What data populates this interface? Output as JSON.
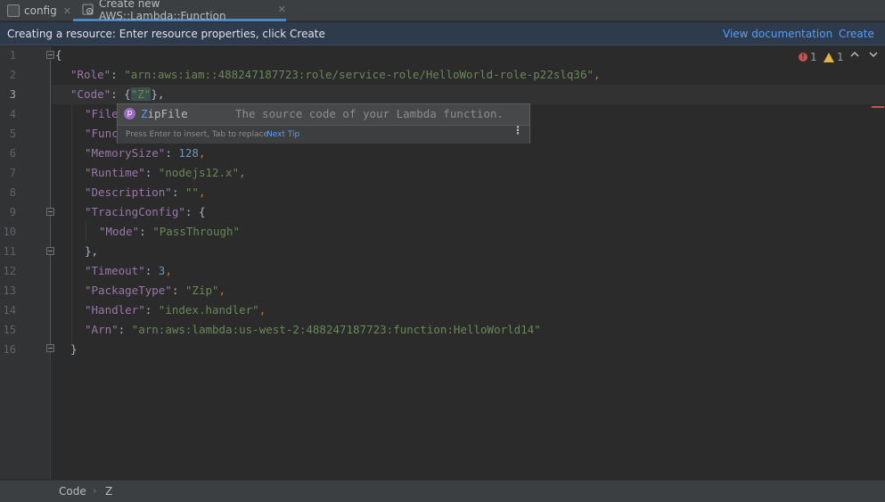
{
  "tabs": [
    {
      "label": "config",
      "close": "✕"
    },
    {
      "label": "Create new AWS::Lambda::Function",
      "close": "✕"
    }
  ],
  "banner": {
    "message": "Creating a resource: Enter resource properties, click Create",
    "doc_link": "View documentation",
    "create_link": "Create"
  },
  "inspections": {
    "errors": "1",
    "warnings": "1"
  },
  "gutter": {
    "line_numbers": [
      "1",
      "2",
      "3",
      "4",
      "5",
      "6",
      "7",
      "8",
      "9",
      "10",
      "11",
      "12",
      "13",
      "14",
      "15",
      "16"
    ],
    "current_line": "3"
  },
  "code": {
    "l1": "{",
    "l2_key": "\"Role\"",
    "l2_val": "\"arn:aws:iam::488247187723:role/service-role/HelloWorld-role-p22slq36\"",
    "l3_key": "\"Code\"",
    "l3_open": "{",
    "l3_val": "\"Z\"",
    "l3_close": "},",
    "l4_key": "\"File",
    "l5_key": "\"Func",
    "l6_key": "\"MemorySize\"",
    "l6_val": "128",
    "l7_key": "\"Runtime\"",
    "l7_val": "\"nodejs12.x\"",
    "l8_key": "\"Description\"",
    "l8_val": "\"\"",
    "l9_key": "\"TracingConfig\"",
    "l9_val": "{",
    "l10_key": "\"Mode\"",
    "l10_val": "\"PassThrough\"",
    "l11": "},",
    "l12_key": "\"Timeout\"",
    "l12_val": "3",
    "l13_key": "\"PackageType\"",
    "l13_val": "\"Zip\"",
    "l14_key": "\"Handler\"",
    "l14_val": "\"index.handler\"",
    "l15_key": "\"Arn\"",
    "l15_val": "\"arn:aws:lambda:us-west-2:488247187723:function:HelloWorld14\"",
    "l16": "}"
  },
  "completion": {
    "icon_letter": "p",
    "match": "Z",
    "rest": "ipFile",
    "description": "The source code of your Lambda function.",
    "hint": "Press Enter to insert, Tab to replace",
    "next_tip": "Next Tip",
    "menu_icon": "⋮"
  },
  "breadcrumb": {
    "items": [
      "Code",
      "Z"
    ],
    "separator": "›"
  },
  "colors": {
    "background": "#2b2b2b",
    "key": "#9876aa",
    "string": "#6a8759",
    "number": "#6897bb",
    "punctuation": "#cc7832",
    "link": "#589df6",
    "error": "#c75450",
    "warning": "#e3b341"
  }
}
